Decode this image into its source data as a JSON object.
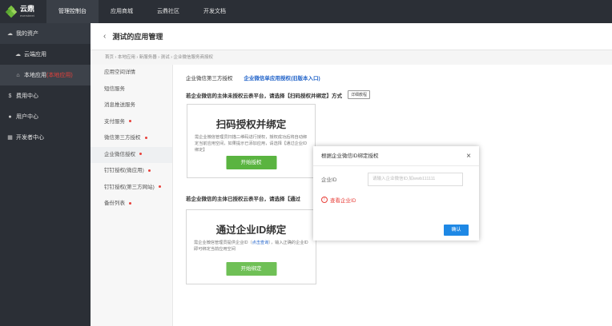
{
  "topbar": {
    "logo_cn": "云鼎",
    "logo_en": "everstreet",
    "nav": [
      "管理控制台",
      "应用商城",
      "云鼎社区",
      "开发文档"
    ]
  },
  "sidebar": {
    "items": [
      {
        "icon": "cloud-icon",
        "label": "我的资产"
      },
      {
        "icon": "cloud-icon",
        "label": "云端应用"
      },
      {
        "icon": "home-icon",
        "label": "本地应用",
        "tag": "(本地应用)"
      },
      {
        "icon": "dollar-icon",
        "label": "费用中心"
      },
      {
        "icon": "user-icon",
        "label": "用户中心"
      },
      {
        "icon": "grid-icon",
        "label": "开发者中心"
      }
    ]
  },
  "header": {
    "back_icon": "chevron-left-icon",
    "title": "测试的应用管理"
  },
  "breadcrumb": "首页 › 本地应用 › 新服务器 › 测试 › 企业微信服务商授权",
  "submenu": [
    {
      "label": "应用空间详情",
      "dot": false,
      "active": false
    },
    {
      "label": "短信服务",
      "dot": false,
      "active": false
    },
    {
      "label": "消息推送服务",
      "dot": false,
      "active": false
    },
    {
      "label": "支付服务",
      "dot": true,
      "active": false
    },
    {
      "label": "微信第三方授权",
      "dot": true,
      "active": false
    },
    {
      "label": "企业微信授权",
      "dot": true,
      "active": true
    },
    {
      "label": "钉钉授权(微应用)",
      "dot": true,
      "active": false
    },
    {
      "label": "钉钉授权(第三方网站)",
      "dot": true,
      "active": false
    },
    {
      "label": "备份列表",
      "dot": true,
      "active": false
    }
  ],
  "main": {
    "row1_label": "企业微信第三方授权",
    "row1_link": "企业微信单应用授权(旧版本入口)",
    "row2_text": "若企业微信的主体未授权云表平台，请选择【扫码授权并绑定】方式",
    "detail_button": "详细教程",
    "card1": {
      "title": "扫码授权并绑定",
      "desc": "需企业微信管理员扫描二维码进行授权，授权成功后将自动绑定当前应用空间，如果提示已添加应用，请选择【通过企业ID绑定】",
      "button": "开始授权"
    },
    "row3_text": "若企业微信的主体已授权云表平台，请选择【通过",
    "card2": {
      "title": "通过企业ID绑定",
      "desc_before": "需企业微信管理员提供企业ID（",
      "desc_link": "点击查询",
      "desc_after": "），输入正确的企业ID即可绑定当前应用空间",
      "button": "开始绑定"
    }
  },
  "modal": {
    "title": "根据企业微信ID绑定授权",
    "close_icon": "close-icon",
    "field_label": "企业ID",
    "field_placeholder": "请输入企业微信ID,如wwb111111",
    "error_icon": "alert-circle-icon",
    "error_text": "查看企业ID",
    "confirm": "确认"
  },
  "colors": {
    "sidebar_bg": "#2b2f36",
    "green": "#5ab440",
    "link_blue": "#1e61c8",
    "confirm_blue": "#1e88e5",
    "error_red": "#e8413b"
  }
}
